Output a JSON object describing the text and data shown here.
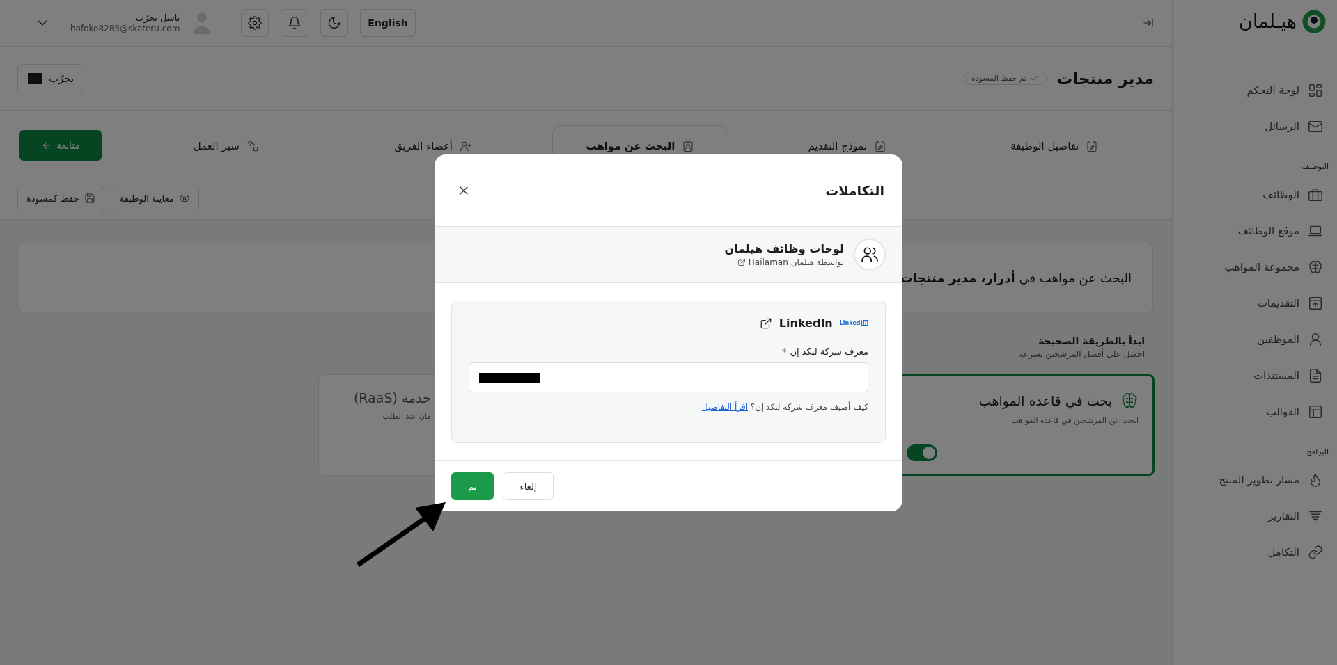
{
  "header": {
    "language_button": "English",
    "user": {
      "name": "باسل يجرّب",
      "email": "bofoko8283@skateru.com"
    }
  },
  "page": {
    "title": "مدير منتجات",
    "draft_badge": "تم حفظ المسودة",
    "company_button": "يجرّب"
  },
  "tabs": [
    {
      "label": "تفاصيل الوظيفة",
      "selected": false
    },
    {
      "label": "نموذج التقديم",
      "selected": false
    },
    {
      "label": "البحث عن مواهب",
      "selected": true
    },
    {
      "label": "أعضاء الفريق",
      "selected": false
    },
    {
      "label": "سير العمل",
      "selected": false
    }
  ],
  "continue_button": "متابعة",
  "actions": [
    "معاينة الوظيفة",
    "حفظ كمسودة"
  ],
  "content": {
    "heading": "البحث عن مواهب في **أدرار، مدير منتجات**",
    "intro_title": "ابدأ بالطريقة الصحيحة",
    "intro_subtitle": "احصل على أفضل المرشحين بسرعة",
    "options": [
      {
        "title": "بحث في قاعدة المواهب",
        "subtitle": "ابحث عن المرشحين في قاعدة المواهب",
        "selected": true,
        "toggle": {
          "on": true
        }
      },
      {
        "title": "خدمة (RaaS)",
        "subtitle": "مان عند الطلب",
        "selected": false
      }
    ]
  },
  "sidebar": {
    "logo": "هيـلمان",
    "groups": [
      {
        "items": [
          "لوحة التحكم",
          "الرسائل"
        ]
      },
      {
        "title": "التوظيف",
        "items": [
          "الوظائف",
          "موقع الوظائف",
          "مجموعة المواهب",
          "التقديمات",
          "الموظفين",
          "المستندات",
          "القوالب"
        ]
      },
      {
        "title": "البرامج",
        "items": [
          "مسار تطوير المنتج",
          "التقارير",
          "التكامل"
        ]
      }
    ]
  },
  "modal": {
    "title": "التكاملات",
    "provider": {
      "name": "لوحات وظائف هيلمان",
      "byline": "بواسطة هيلمان Hailaman"
    },
    "integration": {
      "logo_text": "Linked",
      "logo_box": "in",
      "name": "LinkedIn",
      "field_label": "معرف شركة لنكد إن",
      "required_mark": "*",
      "help_text": "كيف أضيف معرف شركة لنكد إن؟",
      "help_link": "اقرأ التفاصيل"
    },
    "buttons": {
      "cancel": "إلغاء",
      "done": "تم"
    }
  }
}
